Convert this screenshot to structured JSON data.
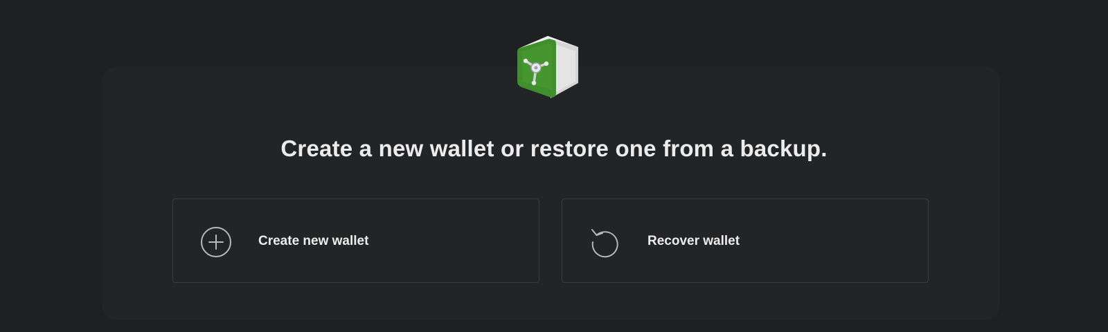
{
  "logo": {
    "icon": "vault-cube-logo-icon",
    "colors": {
      "green": "#3f8f2c",
      "body": "#dcdcdc"
    }
  },
  "headline": "Create a new wallet or restore one from a backup.",
  "options": {
    "create": {
      "label": "Create new wallet",
      "icon": "plus-circle-icon"
    },
    "recover": {
      "label": "Recover wallet",
      "icon": "rotate-ccw-icon"
    }
  },
  "theme": {
    "background": "#1f2022",
    "card": "#232426",
    "border": "#3a3b3e",
    "text": "#ececec",
    "icon": "#b9b9bb"
  }
}
